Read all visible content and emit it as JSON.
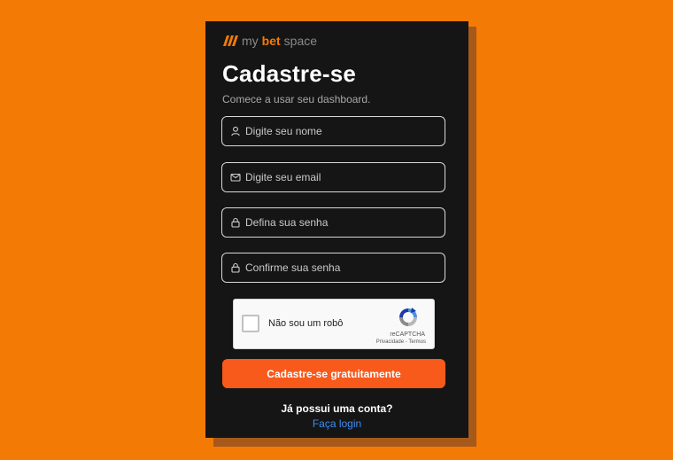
{
  "brand": {
    "my": "my",
    "bet": "bet",
    "space": "space",
    "accent_color": "#f47a06"
  },
  "form": {
    "title": "Cadastre-se",
    "subtitle": "Comece a usar seu dashboard.",
    "fields": [
      {
        "name": "name",
        "icon": "user-icon",
        "placeholder": "Digite seu nome",
        "value": ""
      },
      {
        "name": "email",
        "icon": "mail-icon",
        "placeholder": "Digite seu email",
        "value": ""
      },
      {
        "name": "password",
        "icon": "lock-icon",
        "placeholder": "Defina sua senha",
        "value": ""
      },
      {
        "name": "confirm",
        "icon": "lock-icon",
        "placeholder": "Confirme sua senha",
        "value": ""
      }
    ],
    "recaptcha": {
      "label": "Não sou um robô",
      "brand": "reCAPTCHA",
      "privacy": "Privacidade",
      "separator": " - ",
      "terms": "Termos"
    },
    "submit_label": "Cadastre-se gratuitamente",
    "submit_color": "#f85a1c",
    "have_account": "Já possui uma conta?",
    "login_link": "Faça login"
  },
  "colors": {
    "background": "#f47a06",
    "card": "#151515",
    "link": "#3d8ef2"
  }
}
